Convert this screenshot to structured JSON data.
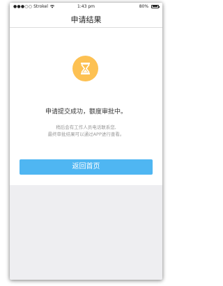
{
  "status_bar": {
    "carrier": "Strokel",
    "signal_dots": "●●●○○",
    "time": "1:43 pm",
    "battery_percent": "80%",
    "battery_level": 0.8
  },
  "nav": {
    "title": "申请结果"
  },
  "result": {
    "icon": "hourglass-icon",
    "icon_color": "#fdc153",
    "message": "申请提交成功，额度审批中。",
    "sub_line_1": "稍后会有工作人员电话联系您,",
    "sub_line_2": "最终审批结果可以通过APP进行查看。"
  },
  "actions": {
    "home_button_label": "返回首页",
    "button_color": "#4fb6f2"
  },
  "colors": {
    "page_background": "#eeeef1"
  }
}
